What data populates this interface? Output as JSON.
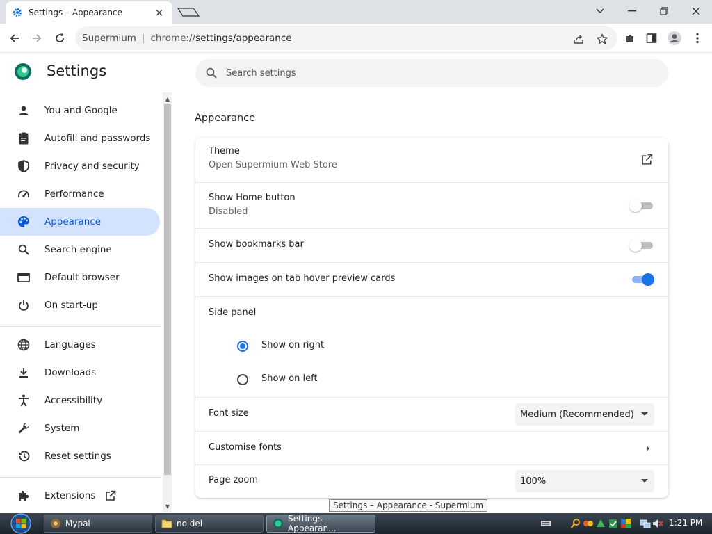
{
  "browser": {
    "tab_title": "Settings – Appearance",
    "tab_close": "×",
    "omnibox_site": "Supermium",
    "omnibox_separator": "|",
    "omnibox_url_prefix": "chrome://",
    "omnibox_url_path": "settings/appearance"
  },
  "settings": {
    "title": "Settings",
    "search_placeholder": "Search settings"
  },
  "sidebar": {
    "items": [
      {
        "label": "You and Google",
        "icon": "person-icon"
      },
      {
        "label": "Autofill and passwords",
        "icon": "clipboard-icon"
      },
      {
        "label": "Privacy and security",
        "icon": "shield-icon"
      },
      {
        "label": "Performance",
        "icon": "speedometer-icon"
      },
      {
        "label": "Appearance",
        "icon": "palette-icon",
        "active": true
      },
      {
        "label": "Search engine",
        "icon": "search-icon"
      },
      {
        "label": "Default browser",
        "icon": "browser-window-icon"
      },
      {
        "label": "On start-up",
        "icon": "power-icon"
      },
      {
        "label": "Languages",
        "icon": "globe-icon"
      },
      {
        "label": "Downloads",
        "icon": "download-icon"
      },
      {
        "label": "Accessibility",
        "icon": "accessibility-icon"
      },
      {
        "label": "System",
        "icon": "wrench-icon"
      },
      {
        "label": "Reset settings",
        "icon": "history-icon"
      },
      {
        "label": "Extensions",
        "icon": "puzzle-icon"
      }
    ]
  },
  "appearance": {
    "section_title": "Appearance",
    "theme_label": "Theme",
    "theme_sub": "Open Supermium Web Store",
    "home_button_label": "Show Home button",
    "home_button_sub": "Disabled",
    "home_button_on": false,
    "bookmarks_bar_label": "Show bookmarks bar",
    "bookmarks_bar_on": false,
    "hover_images_label": "Show images on tab hover preview cards",
    "hover_images_on": true,
    "side_panel_label": "Side panel",
    "side_panel_right": "Show on right",
    "side_panel_left": "Show on left",
    "side_panel_selected": "right",
    "font_size_label": "Font size",
    "font_size_value": "Medium (Recommended)",
    "customise_fonts_label": "Customise fonts",
    "page_zoom_label": "Page zoom",
    "page_zoom_value": "100%"
  },
  "tooltip": "Settings – Appearance - Supermium",
  "taskbar": {
    "buttons": [
      "Mypal",
      "no del",
      "Settings – Appearan..."
    ],
    "clock": "1:21 PM"
  },
  "colors": {
    "accent": "#1a73e8",
    "active_nav_bg": "#d3e3fd",
    "active_nav_text": "#0b57d0"
  }
}
